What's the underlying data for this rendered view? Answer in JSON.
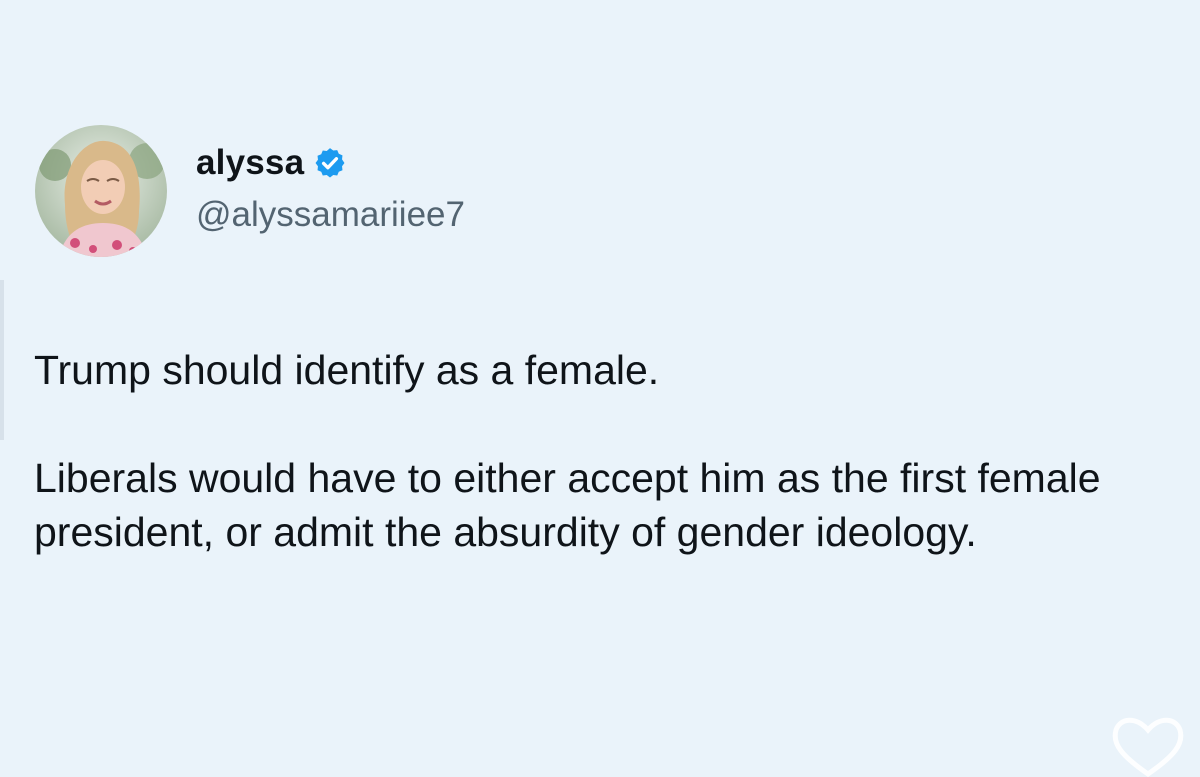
{
  "tweet": {
    "author": {
      "display_name": "alyssa",
      "handle": "@alyssamariiee7",
      "verified": true,
      "avatar_icon": "profile-photo"
    },
    "text_paragraphs": [
      "Trump should identify as a female.",
      "Liberals would have to either accept him as the first female president, or admit the absurdity of gender ideology."
    ]
  },
  "colors": {
    "background": "#eaf3fa",
    "text": "#0f1419",
    "handle_text": "#536471",
    "verified_badge": "#1d9bf0"
  },
  "overlay": {
    "icon": "heart-outline-icon"
  }
}
